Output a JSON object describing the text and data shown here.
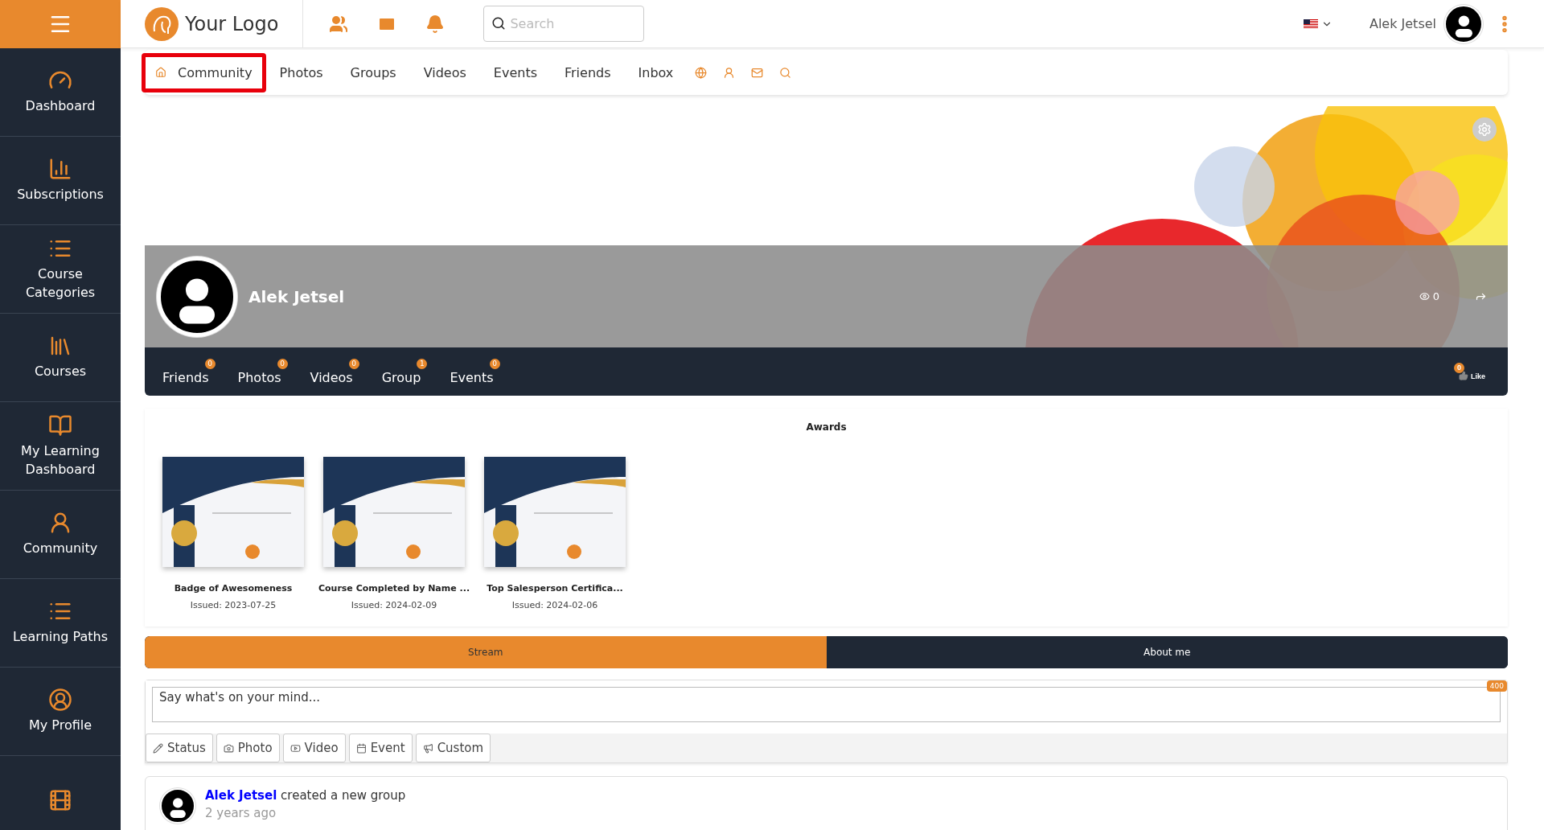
{
  "sidebar": {
    "items": [
      {
        "label": "Dashboard"
      },
      {
        "label": "Subscriptions"
      },
      {
        "label": "Course Categories"
      },
      {
        "label": "Courses"
      },
      {
        "label": "My Learning Dashboard"
      },
      {
        "label": "Community"
      },
      {
        "label": "Learning Paths"
      },
      {
        "label": "My Profile"
      }
    ]
  },
  "topbar": {
    "logo": "Your Logo",
    "search": {
      "placeholder": "Search"
    },
    "user_name": "Alek Jetsel"
  },
  "subnav": {
    "items": [
      {
        "label": "Community",
        "selected": true
      },
      {
        "label": "Photos",
        "selected": false
      },
      {
        "label": "Groups",
        "selected": false
      },
      {
        "label": "Videos",
        "selected": false
      },
      {
        "label": "Events",
        "selected": false
      },
      {
        "label": "Friends",
        "selected": false
      },
      {
        "label": "Inbox",
        "selected": false
      }
    ]
  },
  "profile": {
    "name": "Alek Jetsel",
    "views": "0",
    "tabs": [
      {
        "label": "Friends",
        "count": "0"
      },
      {
        "label": "Photos",
        "count": "0"
      },
      {
        "label": "Videos",
        "count": "0"
      },
      {
        "label": "Group",
        "count": "1"
      },
      {
        "label": "Events",
        "count": "0"
      }
    ],
    "likes": {
      "count": "0",
      "label": "Like"
    }
  },
  "awards": {
    "title": "Awards",
    "items": [
      {
        "name": "Badge of Awesomeness",
        "issued": "Issued: 2023-07-25"
      },
      {
        "name": "Course Completed by Name ...",
        "issued": "Issued: 2024-02-09"
      },
      {
        "name": "Top Salesperson Certifica...",
        "issued": "Issued: 2024-02-06"
      }
    ]
  },
  "stream_tabs": [
    {
      "label": "Stream",
      "selected": true
    },
    {
      "label": "About me",
      "selected": false
    }
  ],
  "composer": {
    "placeholder": "Say what's on your mind...",
    "limit": "400",
    "types": [
      {
        "label": "Status"
      },
      {
        "label": "Photo"
      },
      {
        "label": "Video"
      },
      {
        "label": "Event"
      },
      {
        "label": "Custom"
      }
    ]
  },
  "feed": [
    {
      "author": "Alek Jetsel",
      "action": "created a new group",
      "time": "2 years ago"
    }
  ]
}
